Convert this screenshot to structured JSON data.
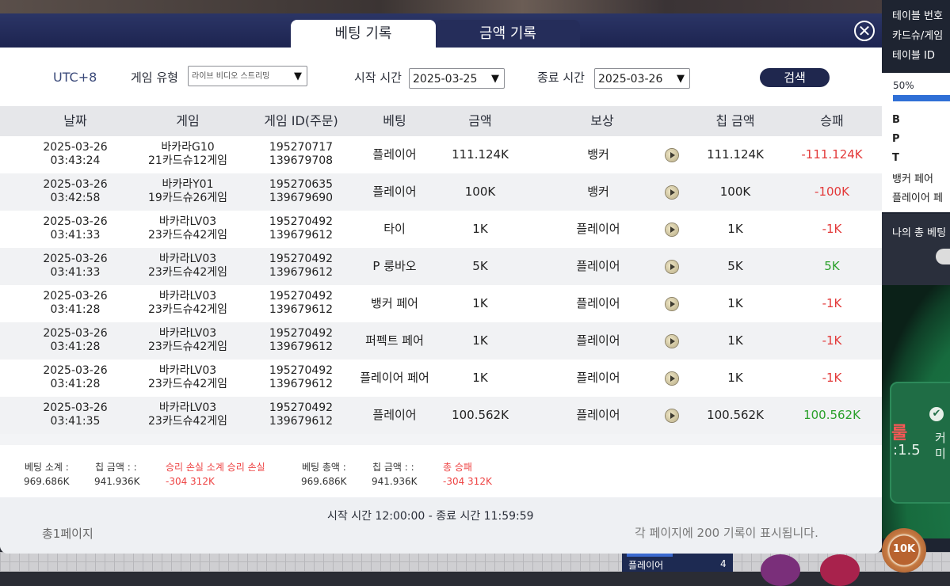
{
  "tabs": {
    "betting_history": "베팅 기록",
    "amount_history": "금액 기록"
  },
  "close_symbol": "✕",
  "filters": {
    "timezone": "UTC+8",
    "game_type_label": "게임 유형",
    "game_type_value": "라이브 비디오 스트리밍",
    "start_label": "시작 시간",
    "start_value": "2025-03-25",
    "end_label": "종료 시간",
    "end_value": "2025-03-26",
    "search_button": "검색",
    "dropdown_arrow": "▼"
  },
  "table": {
    "headers": [
      "날짜",
      "게임",
      "게임 ID(주문)",
      "베팅",
      "금액",
      "보상",
      "칩 금액",
      "승패"
    ],
    "rows": [
      {
        "date": "2025-03-26",
        "time": "03:43:24",
        "game1": "바카라G10",
        "game2": "21카드슈12게임",
        "id1": "195270717",
        "id2": "139679708",
        "bet": "플레이어",
        "amount": "111.124K",
        "reward": "뱅커",
        "chip": "111.124K",
        "result": "-111.124K",
        "result_type": "neg"
      },
      {
        "date": "2025-03-26",
        "time": "03:42:58",
        "game1": "바카라Y01",
        "game2": "19카드슈26게임",
        "id1": "195270635",
        "id2": "139679690",
        "bet": "플레이어",
        "amount": "100K",
        "reward": "뱅커",
        "chip": "100K",
        "result": "-100K",
        "result_type": "neg"
      },
      {
        "date": "2025-03-26",
        "time": "03:41:33",
        "game1": "바카라LV03",
        "game2": "23카드슈42게임",
        "id1": "195270492",
        "id2": "139679612",
        "bet": "타이",
        "amount": "1K",
        "reward": "플레이어",
        "chip": "1K",
        "result": "-1K",
        "result_type": "neg"
      },
      {
        "date": "2025-03-26",
        "time": "03:41:33",
        "game1": "바카라LV03",
        "game2": "23카드슈42게임",
        "id1": "195270492",
        "id2": "139679612",
        "bet": "P 룽바오",
        "amount": "5K",
        "reward": "플레이어",
        "chip": "5K",
        "result": "5K",
        "result_type": "pos"
      },
      {
        "date": "2025-03-26",
        "time": "03:41:28",
        "game1": "바카라LV03",
        "game2": "23카드슈42게임",
        "id1": "195270492",
        "id2": "139679612",
        "bet": "뱅커 페어",
        "amount": "1K",
        "reward": "플레이어",
        "chip": "1K",
        "result": "-1K",
        "result_type": "neg"
      },
      {
        "date": "2025-03-26",
        "time": "03:41:28",
        "game1": "바카라LV03",
        "game2": "23카드슈42게임",
        "id1": "195270492",
        "id2": "139679612",
        "bet": "퍼펙트 페어",
        "amount": "1K",
        "reward": "플레이어",
        "chip": "1K",
        "result": "-1K",
        "result_type": "neg"
      },
      {
        "date": "2025-03-26",
        "time": "03:41:28",
        "game1": "바카라LV03",
        "game2": "23카드슈42게임",
        "id1": "195270492",
        "id2": "139679612",
        "bet": "플레이어 페어",
        "amount": "1K",
        "reward": "플레이어",
        "chip": "1K",
        "result": "-1K",
        "result_type": "neg"
      },
      {
        "date": "2025-03-26",
        "time": "03:41:35",
        "game1": "바카라LV03",
        "game2": "23카드슈42게임",
        "id1": "195270492",
        "id2": "139679612",
        "bet": "플레이어",
        "amount": "100.562K",
        "reward": "플레이어",
        "chip": "100.562K",
        "result": "100.562K",
        "result_type": "pos"
      }
    ]
  },
  "summary": {
    "bet_subtotal_label": "베팅 소계 :",
    "bet_subtotal_value": "969.686K",
    "chip_amount_label_1": "칩 금액 : :",
    "chip_amount_value_1": "941.936K",
    "winloss_subtotal_label": "승리 손실 소계  승리 손실",
    "winloss_subtotal_value": "-304 312K",
    "bet_total_label": "베팅 총액 :",
    "bet_total_value": "969.686K",
    "chip_amount_label_2": "칩 금액 : :",
    "chip_amount_value_2": "941.936K",
    "total_winloss_label": "총 승패",
    "total_winloss_value": "-304 312K"
  },
  "footer": {
    "time_range": "시작 시간 12:00:00 - 종료 시간 11:59:59",
    "total_pages": "총1페이지",
    "per_page_note": "각 페이지에 200 기록이 표시됩니다."
  },
  "side_panel": {
    "info": [
      "테이블 번호",
      "카드슈/게임",
      "테이블 ID"
    ],
    "percent": "50%",
    "stat_rows": [
      "B",
      "P",
      "T",
      "뱅커 페어",
      "플레이어 페"
    ],
    "my_total_bet": "나의 총 베팅",
    "table_text_1": "룰",
    "table_text_2": ":1.5",
    "table_text_3": "커",
    "table_text_4": "미"
  },
  "bottom_bar": {
    "label": "플레이어",
    "count": "4",
    "chip_value": "10K"
  },
  "colors": {
    "header_navy": "#1d2450",
    "negative": "#e33a3a",
    "positive": "#2aa02a",
    "search_button": "#1f274e"
  }
}
